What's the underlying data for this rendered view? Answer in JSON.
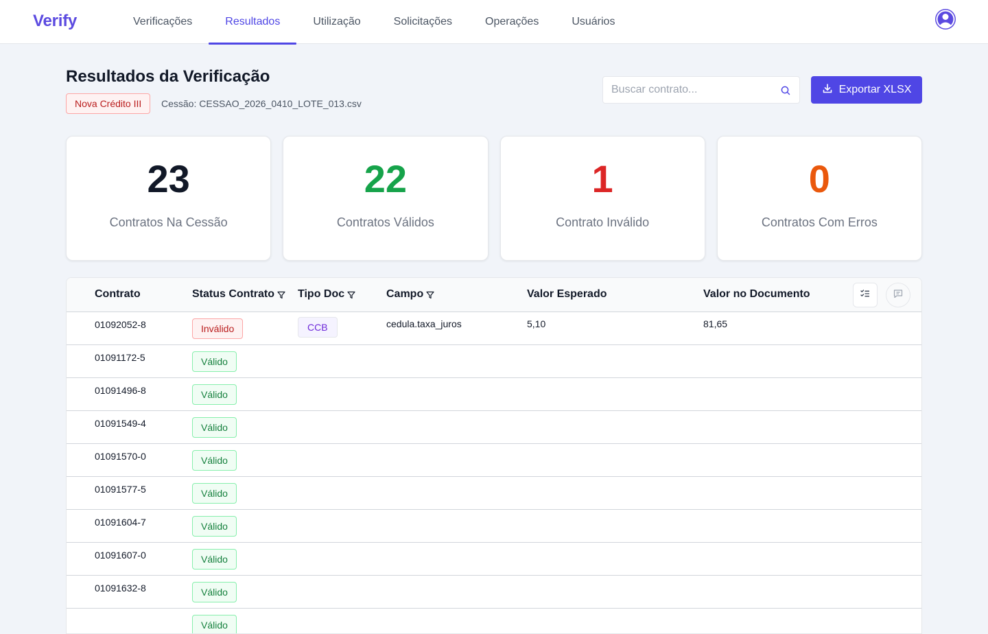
{
  "header": {
    "brand": "Verify",
    "nav": [
      {
        "label": "Verificações",
        "active": false
      },
      {
        "label": "Resultados",
        "active": true
      },
      {
        "label": "Utilização",
        "active": false
      },
      {
        "label": "Solicitações",
        "active": false
      },
      {
        "label": "Operações",
        "active": false
      },
      {
        "label": "Usuários",
        "active": false
      }
    ],
    "avatar_icon": "user-avatar-icon"
  },
  "page": {
    "title": "Resultados da Verificação",
    "source_badge": "Nova Crédito III",
    "session": "Cessão: CESSAO_2026_0410_LOTE_013.csv",
    "search_placeholder": "Buscar contrato...",
    "export_label": "Exportar XLSX"
  },
  "stats": [
    {
      "value": "23",
      "label": "Contratos Na Cessão",
      "color": "#111827"
    },
    {
      "value": "22",
      "label": "Contratos Válidos",
      "color": "#16a34a"
    },
    {
      "value": "1",
      "label": "Contrato Inválido",
      "color": "#dc2626"
    },
    {
      "value": "0",
      "label": "Contratos Com Erros",
      "color": "#ea580c"
    }
  ],
  "table": {
    "columns": {
      "contrato": "Contrato",
      "status": "Status Contrato",
      "tipo_doc": "Tipo Doc",
      "campo": "Campo",
      "valor_esperado": "Valor Esperado",
      "valor_documento": "Valor no Documento"
    },
    "rows": [
      {
        "contrato": "01092052-8",
        "status": "Inválido",
        "tipo_doc": "CCB",
        "campo": "cedula.taxa_juros",
        "valor_esperado": "5,10",
        "valor_documento": "81,65"
      },
      {
        "contrato": "01091172-5",
        "status": "Válido"
      },
      {
        "contrato": "01091496-8",
        "status": "Válido"
      },
      {
        "contrato": "01091549-4",
        "status": "Válido"
      },
      {
        "contrato": "01091570-0",
        "status": "Válido"
      },
      {
        "contrato": "01091577-5",
        "status": "Válido"
      },
      {
        "contrato": "01091604-7",
        "status": "Válido"
      },
      {
        "contrato": "01091607-0",
        "status": "Válido"
      },
      {
        "contrato": "01091632-8",
        "status": "Válido"
      },
      {
        "contrato": "",
        "status": "Válido"
      }
    ]
  }
}
